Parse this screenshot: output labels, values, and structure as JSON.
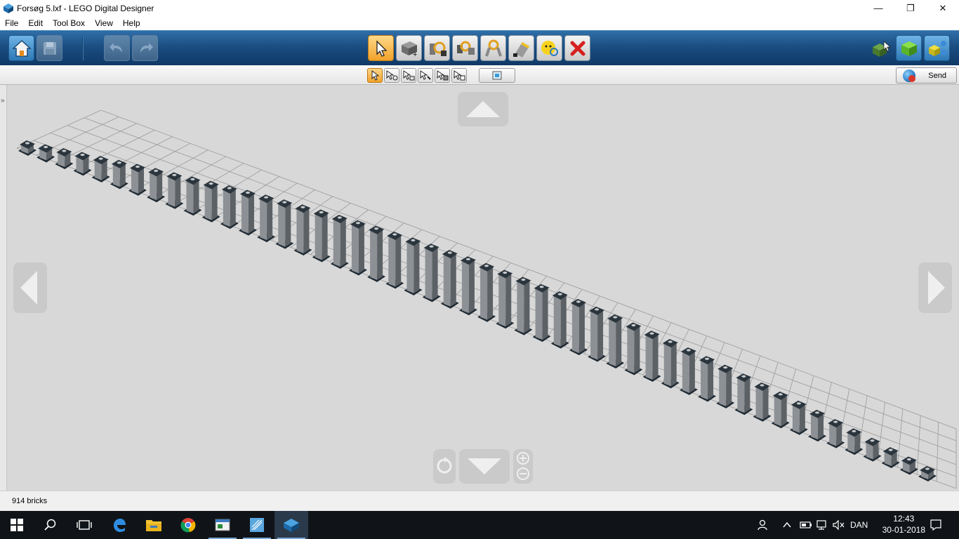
{
  "window": {
    "title": "Forsøg 5.lxf - LEGO Digital Designer",
    "minimize": "—",
    "maximize": "❐",
    "close": "✕"
  },
  "menu": [
    "File",
    "Edit",
    "Tool Box",
    "View",
    "Help"
  ],
  "toolbar": {
    "left_icons": [
      "home-icon",
      "save-icon",
      "undo-icon",
      "redo-icon"
    ],
    "tools": [
      "select-tool-icon",
      "clone-tool-icon",
      "hinge-tool-icon",
      "hinge-align-tool-icon",
      "flex-tool-icon",
      "paint-tool-icon",
      "hide-tool-icon",
      "delete-tool-icon"
    ],
    "active_tool": "select-tool-icon",
    "right_icons": [
      "build-mode-icon",
      "view-mode-icon",
      "building-guide-icon"
    ]
  },
  "subtoolbar": {
    "select_modes": [
      "single-select-icon",
      "multi-select-icon",
      "select-connected-icon",
      "select-same-color-icon",
      "select-same-brick-icon",
      "invert-select-icon"
    ],
    "group_icon": "group-icon",
    "send_label": "Send"
  },
  "scene": {
    "description_free": true,
    "brick_count_visible": 50
  },
  "statusbar": {
    "brick_count": "914 bricks"
  },
  "taskbar": {
    "apps": [
      "start-icon",
      "search-icon",
      "task-view-icon",
      "edge-icon",
      "file-explorer-icon",
      "chrome-icon",
      "app-window-icon",
      "sketch-app-icon",
      "lego-designer-icon"
    ],
    "language": "DAN",
    "time": "12:43",
    "date": "30-01-2018"
  },
  "colors": {
    "toolbar_blue": "#1b4e82",
    "viewport_gray": "#d8d8d8",
    "active_orange": "#f0a22a"
  }
}
